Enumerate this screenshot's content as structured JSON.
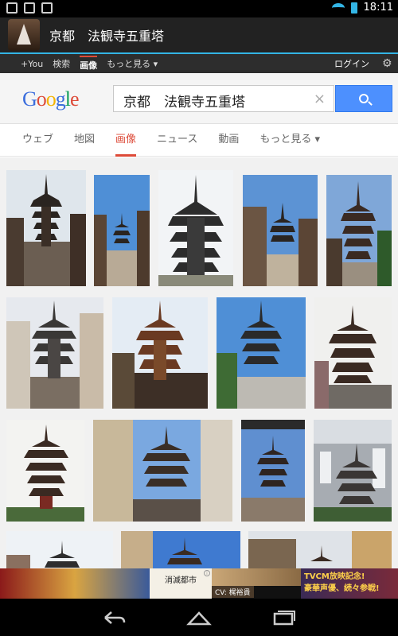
{
  "status_bar": {
    "time": "18:11"
  },
  "action_bar": {
    "title": "京都　法観寺五重塔"
  },
  "google_bar": {
    "items": [
      "+You",
      "検索",
      "画像",
      "もっと見る ▾"
    ],
    "active_index": 2,
    "login_label": "ログイン"
  },
  "search": {
    "logo_letters": [
      {
        "ch": "G",
        "color": "#3b6ddc"
      },
      {
        "ch": "o",
        "color": "#dd4b39"
      },
      {
        "ch": "o",
        "color": "#f4b400"
      },
      {
        "ch": "g",
        "color": "#3b6ddc"
      },
      {
        "ch": "l",
        "color": "#0f9d58"
      },
      {
        "ch": "e",
        "color": "#dd4b39"
      }
    ],
    "query": "京都　法観寺五重塔",
    "clear_symbol": "×"
  },
  "tabs": {
    "items": [
      "ウェブ",
      "地図",
      "画像",
      "ニュース",
      "動画",
      "もっと見る ▾"
    ],
    "active_index": 2
  },
  "ad": {
    "mid_text": "消滅都市",
    "cv_text": "CV: 梶裕貴",
    "right_line1": "TVCM放映記念!",
    "right_line2": "豪華声優、続々参戦!"
  },
  "icons": [
    "back-icon",
    "home-icon",
    "recent-apps-icon",
    "search-icon",
    "gear-icon",
    "wifi-icon",
    "battery-icon"
  ]
}
